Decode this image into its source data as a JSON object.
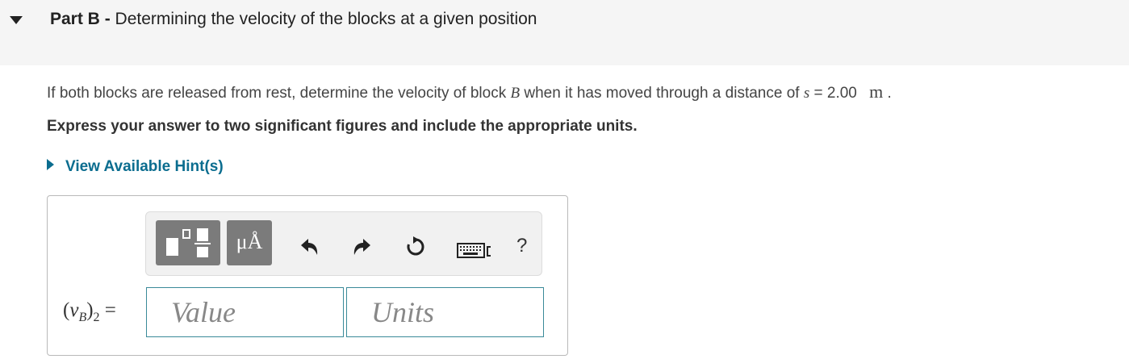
{
  "header": {
    "part_label": "Part B",
    "separator": " - ",
    "title": "Determining the velocity of the blocks at a given position"
  },
  "question": {
    "text_before": "If both blocks are released from rest, determine the velocity of block ",
    "block": "B",
    "text_middle": " when it has moved through a distance of ",
    "var": "s",
    "equals_value": " = 2.00 ",
    "unit": "m",
    "period": " ."
  },
  "instruction": "Express your answer to two significant figures and include the appropriate units.",
  "hint_label": "View Available Hint(s)",
  "toolbar": {
    "units_button_label": "μÅ",
    "help_label": "?",
    "icons": [
      "templates-icon",
      "units-icon",
      "undo-icon",
      "redo-icon",
      "reset-icon",
      "keyboard-icon",
      "help-icon"
    ]
  },
  "answer": {
    "lhs_open": "(",
    "lhs_var": "v",
    "lhs_sub": "B",
    "lhs_close": ")",
    "lhs_sub2": "2",
    "equals": " =",
    "value_placeholder": "Value",
    "units_placeholder": "Units"
  },
  "colors": {
    "header_bg": "#f5f5f5",
    "hint_link": "#0b6d8f",
    "field_border": "#3a8a99",
    "toolbar_button": "#7b7b7b"
  }
}
